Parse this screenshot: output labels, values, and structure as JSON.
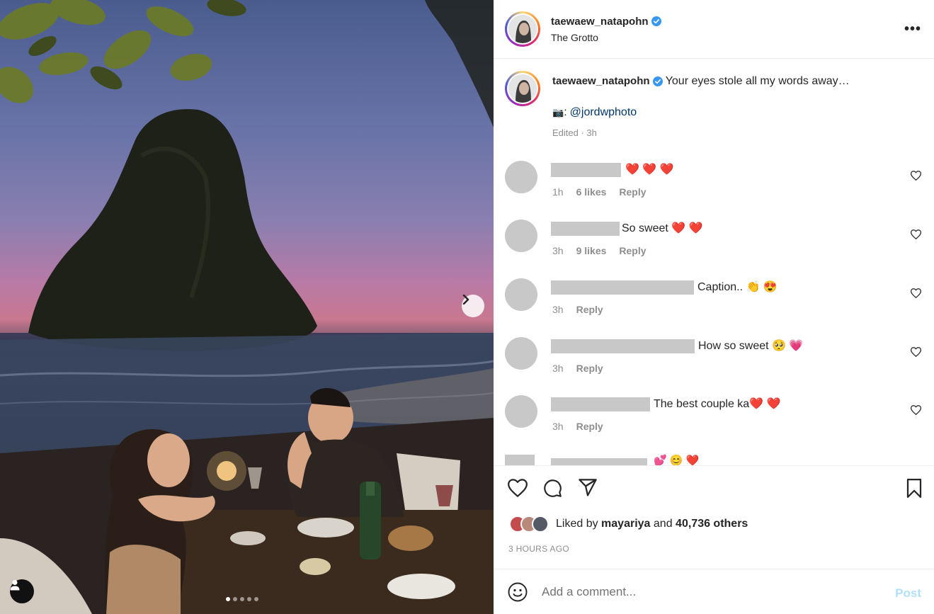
{
  "post": {
    "username": "taewaew_natapohn",
    "location": "The Grotto",
    "more_label": "•••"
  },
  "caption": {
    "username": "taewaew_natapohn",
    "text": "Your eyes stole all my words away…",
    "camera_emoji": "📷",
    "colon": ":",
    "mention": "@jordwphoto",
    "meta": "Edited · 3h"
  },
  "comments": [
    {
      "text": "❤️ ❤️ ❤️",
      "time": "1h",
      "likes": "6 likes",
      "reply": "Reply"
    },
    {
      "text": "So sweet ❤️ ❤️",
      "time": "3h",
      "likes": "9 likes",
      "reply": "Reply"
    },
    {
      "text": "Caption.. 👏 😍",
      "time": "3h",
      "likes": "",
      "reply": "Reply"
    },
    {
      "text": "How so sweet 🥺 💗",
      "time": "3h",
      "likes": "",
      "reply": "Reply"
    },
    {
      "text": "The best couple ka❤️ ❤️",
      "time": "3h",
      "likes": "",
      "reply": "Reply"
    }
  ],
  "partial_comment_text": "💕 😊 ❤️",
  "likes": {
    "prefix": "Liked by",
    "first_liker": "mayariya",
    "middle": "and",
    "others": "40,736 others"
  },
  "timestamp": "3 HOURS AGO",
  "add_comment": {
    "placeholder": "Add a comment...",
    "post_label": "Post"
  },
  "carousel": {
    "total_slides": 5,
    "current_slide": 1
  },
  "colors": {
    "verified_blue": "#3897f0",
    "redaction_gray": "#c8c8c8",
    "post_button_disabled": "#b2dffc",
    "mention_blue": "#00376b"
  }
}
